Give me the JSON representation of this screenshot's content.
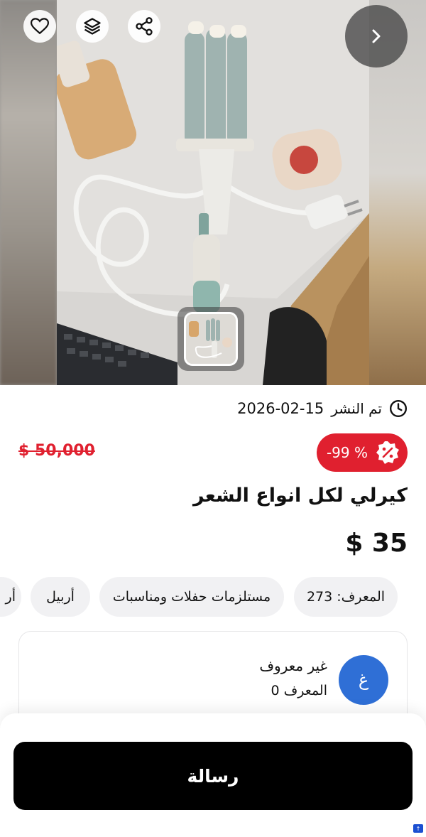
{
  "post": {
    "published_label": "تم النشر",
    "published_date": "2026-02-15"
  },
  "pricing": {
    "discount_text": "-99 %",
    "old_price": "$ 50,000",
    "price": "$ 35"
  },
  "product": {
    "title": "كيرلي لكل انواع الشعر"
  },
  "chips": [
    {
      "label": "المعرف: 273"
    },
    {
      "label": "مستلزمات حفلات ومناسبات"
    },
    {
      "label": "أربيل"
    },
    {
      "label": "أر"
    }
  ],
  "seller": {
    "avatar_letter": "غ",
    "name": "غير معروف",
    "id_text": "المعرف 0"
  },
  "actions": {
    "message_label": "رسالة"
  },
  "icons": {
    "favorite": "heart-icon",
    "layers": "layers-icon",
    "share": "share-icon",
    "next": "chevron-right-icon",
    "clock": "clock-icon",
    "discount": "percent-badge-icon"
  },
  "colors": {
    "discount_red": "#e0202f",
    "avatar_blue": "#2f6fd6",
    "button_black": "#000000"
  }
}
